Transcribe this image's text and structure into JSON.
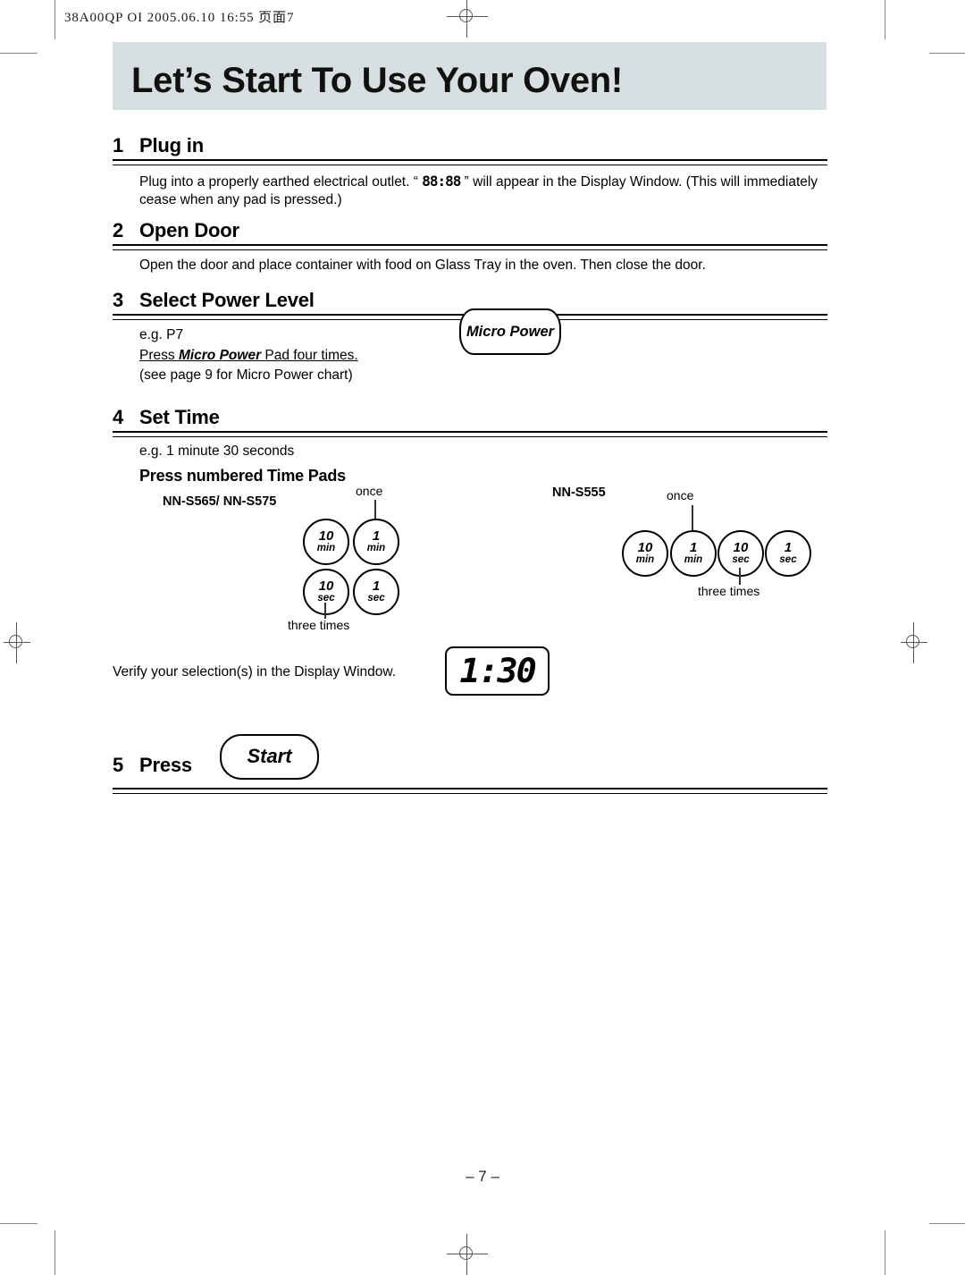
{
  "printer_header": "38A00QP OI  2005.06.10 16:55  页面7",
  "title": "Let’s Start To Use Your Oven!",
  "steps": [
    {
      "num": "1",
      "title": "Plug in",
      "body_pre": "Plug into a properly earthed electrical outlet. “ ",
      "body_seg": "88:88",
      "body_post": " ” will appear in the Display Window. (This will immediately cease when any pad is pressed.)"
    },
    {
      "num": "2",
      "title": "Open Door",
      "body": "Open the door and place container with food on Glass Tray in the oven. Then close the door."
    },
    {
      "num": "3",
      "title": "Select Power Level",
      "line1": "e.g. P7",
      "line2_a": "Press ",
      "line2_b": "Micro Power",
      "line2_c": " Pad four times.",
      "line3": "(see page 9 for Micro Power chart)",
      "pad_label": "Micro Power"
    },
    {
      "num": "4",
      "title": "Set Time",
      "line1": "e.g. 1 minute 30 seconds",
      "subhead": "Press numbered Time Pads"
    },
    {
      "num": "5",
      "title": "Press",
      "pad_label": "Start"
    }
  ],
  "pads": {
    "group_a": {
      "model_label": "NN-S565/ NN-S575",
      "callout_once": "once",
      "callout_three": "three times",
      "buttons": [
        {
          "value": "10",
          "unit": "min"
        },
        {
          "value": "1",
          "unit": "min"
        },
        {
          "value": "10",
          "unit": "sec"
        },
        {
          "value": "1",
          "unit": "sec"
        }
      ]
    },
    "group_b": {
      "model_label": "NN-S555",
      "callout_once": "once",
      "callout_three": "three times",
      "buttons": [
        {
          "value": "10",
          "unit": "min"
        },
        {
          "value": "1",
          "unit": "min"
        },
        {
          "value": "10",
          "unit": "sec"
        },
        {
          "value": "1",
          "unit": "sec"
        }
      ]
    }
  },
  "verify": {
    "text": "Verify your selection(s) in the Display Window.",
    "display_value": "1:30"
  },
  "footer": "– 7 –",
  "colors": {
    "title_band": "#d7dfe0",
    "ink": "#000000"
  }
}
